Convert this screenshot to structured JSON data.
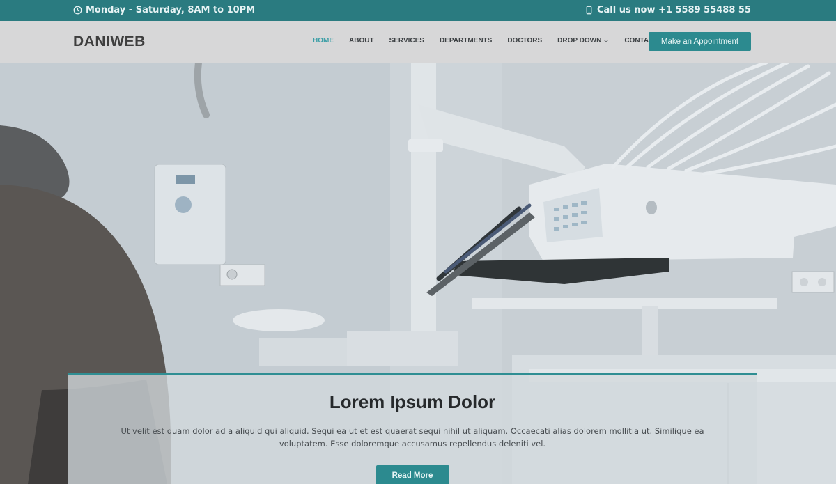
{
  "topbar": {
    "hours": "Monday - Saturday, 8AM to 10PM",
    "phone": "Call us now +1 5589 55488 55"
  },
  "header": {
    "logo": "DANIWEB",
    "nav": [
      "HOME",
      "ABOUT",
      "SERVICES",
      "DEPARTMENTS",
      "DOCTORS",
      "DROP DOWN",
      "CONTACT"
    ],
    "cta": "Make an Appointment"
  },
  "hero": {
    "title": "Lorem Ipsum Dolor",
    "text": "Ut velit est quam dolor ad a aliquid qui aliquid. Sequi ea ut et est quaerat sequi nihil ut aliquam. Occaecati alias dolorem mollitia ut. Similique ea voluptatem. Esse doloremque accusamus repellendus deleniti vel.",
    "button": "Read More"
  },
  "colors": {
    "accent": "#2a7b80",
    "active_nav": "#3b9ea6"
  }
}
